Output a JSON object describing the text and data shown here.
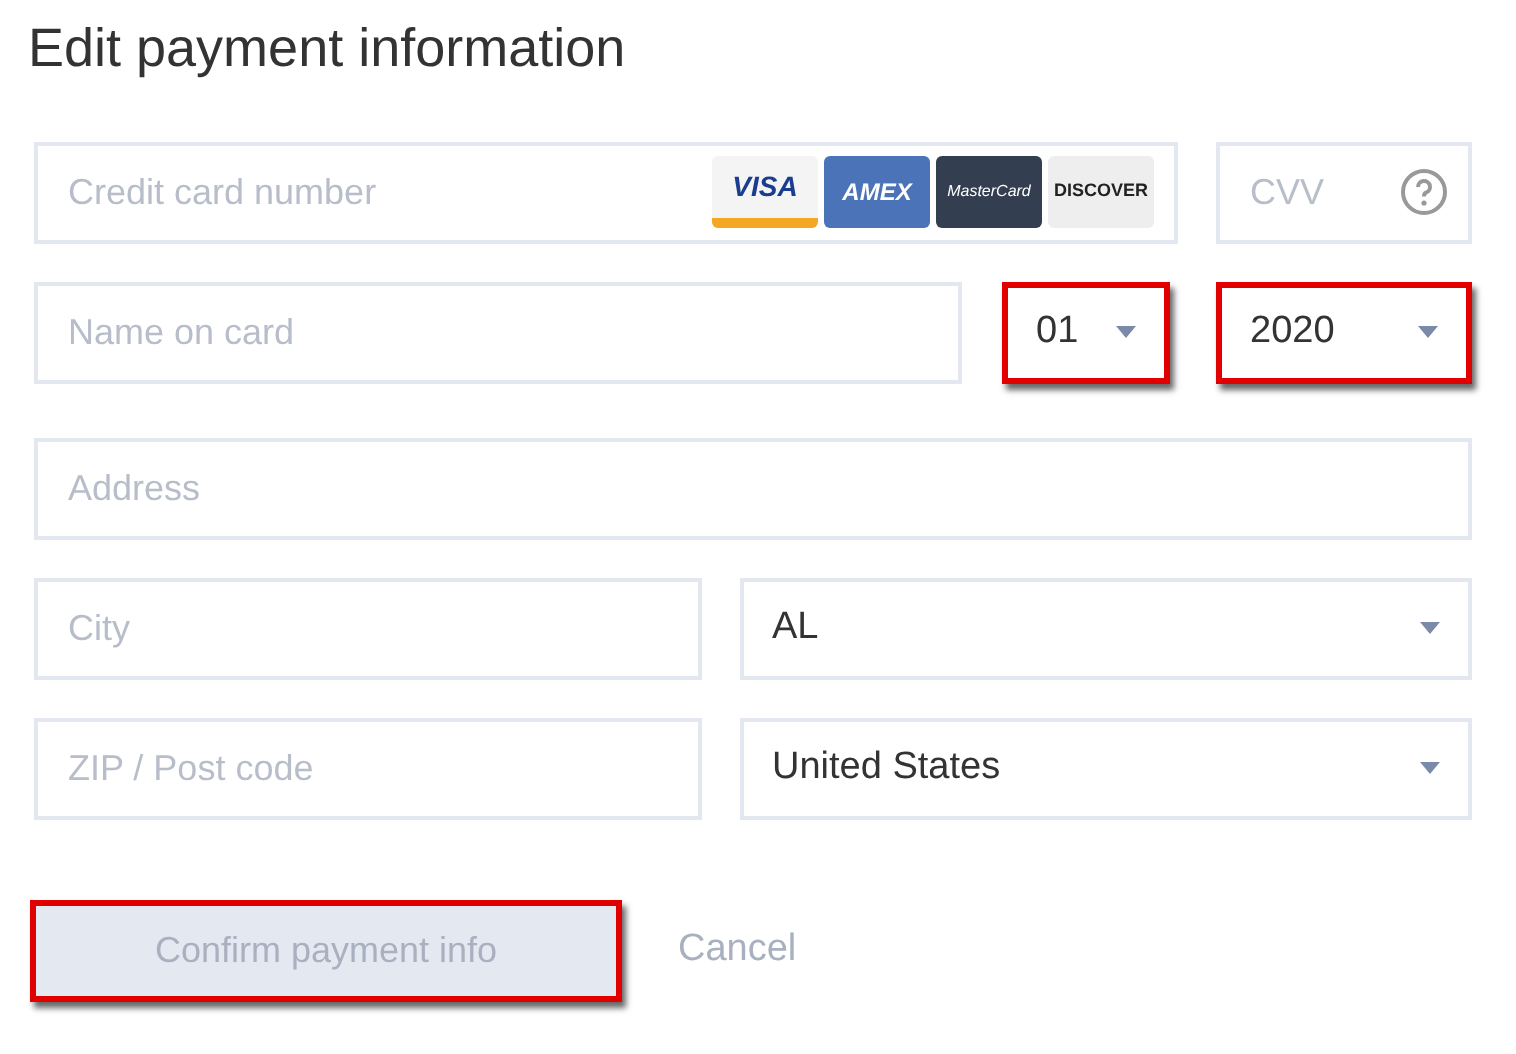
{
  "title": "Edit payment information",
  "card_number": {
    "placeholder": "Credit card number",
    "highlighted": false
  },
  "card_logos": [
    {
      "kind": "visa",
      "text": "VISA"
    },
    {
      "kind": "amex",
      "text": "AMEX"
    },
    {
      "kind": "mastercard",
      "text": "MasterCard"
    },
    {
      "kind": "discover",
      "text": "DISCOVER"
    }
  ],
  "cvv": {
    "placeholder": "CVV",
    "highlighted": false
  },
  "name_on_card": {
    "placeholder": "Name on card",
    "highlighted": false
  },
  "exp_month": {
    "value": "01",
    "highlighted": true
  },
  "exp_year": {
    "value": "2020",
    "highlighted": true
  },
  "address": {
    "placeholder": "Address",
    "highlighted": false
  },
  "city": {
    "placeholder": "City",
    "highlighted": false
  },
  "state": {
    "value": "AL",
    "highlighted": false
  },
  "zip": {
    "placeholder": "ZIP / Post code",
    "highlighted": false
  },
  "country": {
    "value": "United States",
    "highlighted": false
  },
  "confirm_button": {
    "label": "Confirm payment info",
    "disabled": true,
    "highlighted": true
  },
  "cancel_link": {
    "label": "Cancel"
  }
}
